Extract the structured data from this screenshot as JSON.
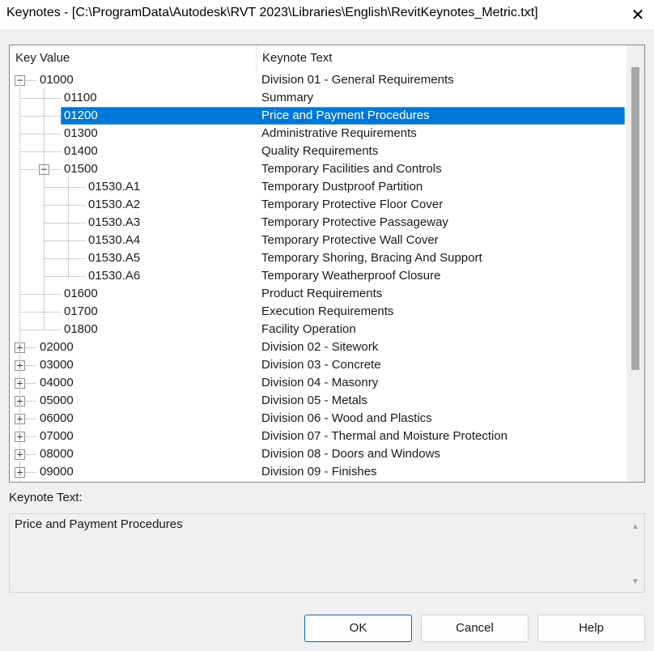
{
  "window": {
    "title": "Keynotes - [C:\\ProgramData\\Autodesk\\RVT 2023\\Libraries\\English\\RevitKeynotes_Metric.txt]",
    "close_glyph": "✕"
  },
  "tree": {
    "columns": {
      "key": "Key Value",
      "text": "Keynote Text"
    },
    "rows": [
      {
        "key": "01000",
        "text": "Division 01 - General Requirements",
        "level": 0,
        "expander": "−"
      },
      {
        "key": "01100",
        "text": "Summary",
        "level": 1,
        "expander": ""
      },
      {
        "key": "01200",
        "text": "Price and Payment Procedures",
        "level": 1,
        "expander": "",
        "selected": true
      },
      {
        "key": "01300",
        "text": "Administrative Requirements",
        "level": 1,
        "expander": ""
      },
      {
        "key": "01400",
        "text": "Quality Requirements",
        "level": 1,
        "expander": ""
      },
      {
        "key": "01500",
        "text": "Temporary Facilities and Controls",
        "level": 1,
        "expander": "−"
      },
      {
        "key": "01530.A1",
        "text": "Temporary Dustproof Partition",
        "level": 2,
        "expander": ""
      },
      {
        "key": "01530.A2",
        "text": "Temporary Protective Floor Cover",
        "level": 2,
        "expander": ""
      },
      {
        "key": "01530.A3",
        "text": "Temporary Protective Passageway",
        "level": 2,
        "expander": ""
      },
      {
        "key": "01530.A4",
        "text": "Temporary Protective Wall Cover",
        "level": 2,
        "expander": ""
      },
      {
        "key": "01530.A5",
        "text": "Temporary Shoring, Bracing And Support",
        "level": 2,
        "expander": ""
      },
      {
        "key": "01530.A6",
        "text": "Temporary Weatherproof Closure",
        "level": 2,
        "expander": ""
      },
      {
        "key": "01600",
        "text": "Product Requirements",
        "level": 1,
        "expander": ""
      },
      {
        "key": "01700",
        "text": "Execution Requirements",
        "level": 1,
        "expander": ""
      },
      {
        "key": "01800",
        "text": "Facility Operation",
        "level": 1,
        "expander": ""
      },
      {
        "key": "02000",
        "text": "Division 02 - Sitework",
        "level": 0,
        "expander": "+"
      },
      {
        "key": "03000",
        "text": "Division 03 - Concrete",
        "level": 0,
        "expander": "+"
      },
      {
        "key": "04000",
        "text": "Division 04 - Masonry",
        "level": 0,
        "expander": "+"
      },
      {
        "key": "05000",
        "text": "Division 05 - Metals",
        "level": 0,
        "expander": "+"
      },
      {
        "key": "06000",
        "text": "Division 06 - Wood and Plastics",
        "level": 0,
        "expander": "+"
      },
      {
        "key": "07000",
        "text": "Division 07 - Thermal and Moisture Protection",
        "level": 0,
        "expander": "+"
      },
      {
        "key": "08000",
        "text": "Division 08 - Doors and Windows",
        "level": 0,
        "expander": "+"
      },
      {
        "key": "09000",
        "text": "Division 09 - Finishes",
        "level": 0,
        "expander": "+"
      }
    ]
  },
  "details": {
    "label": "Keynote Text:",
    "value": "Price and Payment Procedures",
    "up_arrow": "▲",
    "down_arrow": "▼"
  },
  "buttons": {
    "ok": "OK",
    "cancel": "Cancel",
    "help": "Help"
  },
  "colors": {
    "selection": "#0078d7",
    "ok_border": "#0067c0"
  }
}
